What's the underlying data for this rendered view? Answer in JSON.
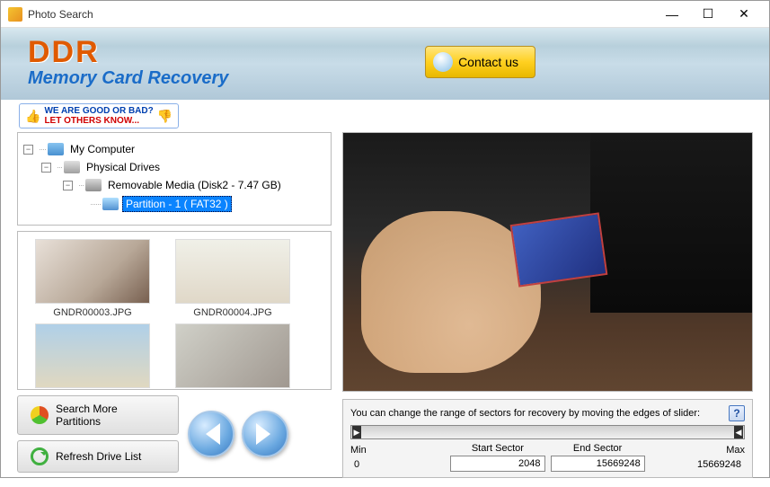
{
  "window": {
    "title": "Photo Search"
  },
  "header": {
    "logo": "DDR",
    "subtitle": "Memory Card Recovery",
    "contact_label": "Contact us"
  },
  "feedback": {
    "line1": "WE ARE GOOD OR BAD?",
    "line2": "LET OTHERS KNOW..."
  },
  "tree": {
    "root": "My Computer",
    "physical": "Physical Drives",
    "media": "Removable Media (Disk2 - 7.47 GB)",
    "partition": "Partition - 1 ( FAT32 )"
  },
  "thumbs": [
    {
      "name": "GNDR00003.JPG"
    },
    {
      "name": "GNDR00004.JPG"
    },
    {
      "name": ""
    },
    {
      "name": ""
    }
  ],
  "buttons": {
    "search_more": "Search More Partitions",
    "refresh": "Refresh Drive List"
  },
  "sectors": {
    "instruction": "You can change the range of sectors for recovery by moving the edges of slider:",
    "min_label": "Min",
    "start_label": "Start Sector",
    "end_label": "End Sector",
    "max_label": "Max",
    "min": "0",
    "start": "2048",
    "end": "15669248",
    "max": "15669248"
  }
}
